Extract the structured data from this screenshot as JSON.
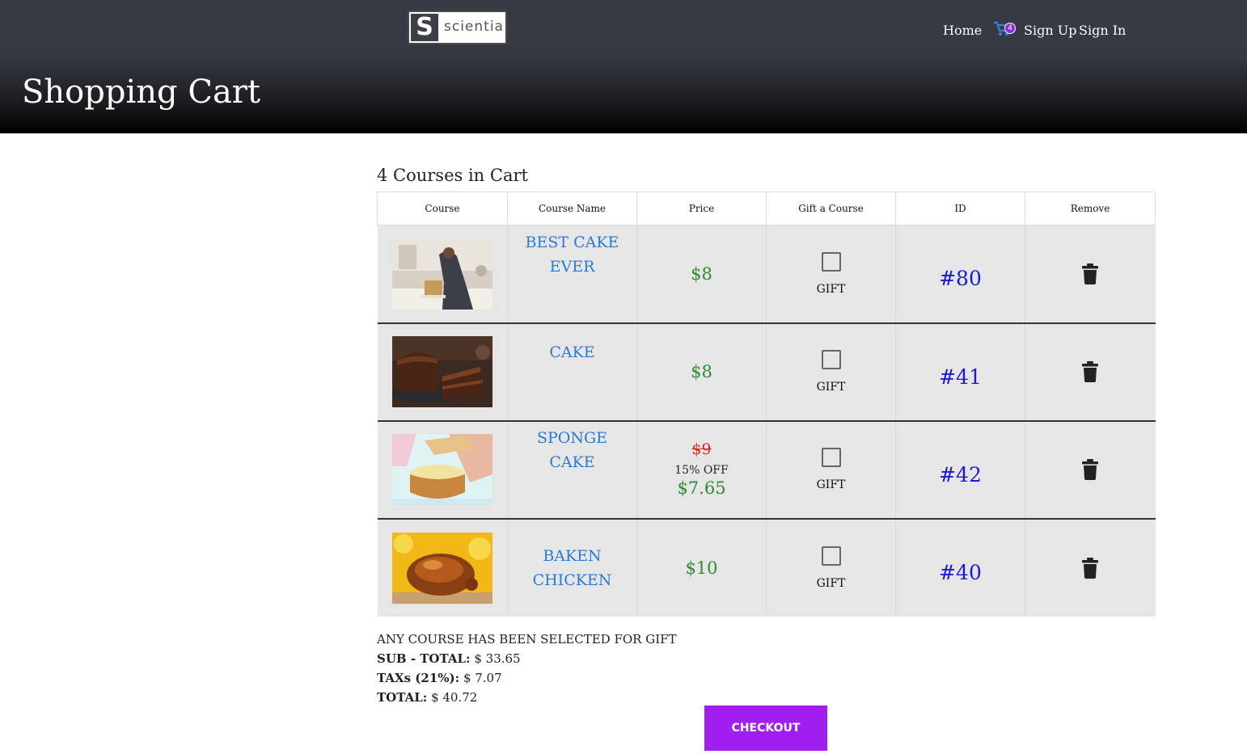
{
  "brand": {
    "logo_letter": "S",
    "logo_text": "scientia"
  },
  "nav": {
    "home": "Home",
    "cart_count": "4",
    "sign_up": "Sign Up",
    "sign_in": "Sign In"
  },
  "page": {
    "title": "Shopping Cart"
  },
  "cart": {
    "heading": "4 Courses in Cart",
    "columns": [
      "Course",
      "Course Name",
      "Price",
      "Gift a Course",
      "ID",
      "Remove"
    ],
    "items": [
      {
        "name": "BEST CAKE EVER",
        "price": "$8",
        "gift_label": "GIFT",
        "gift_checked": false,
        "id": "#80",
        "image": "baker-decorating-cake"
      },
      {
        "name": "CAKE",
        "price": "$8",
        "gift_label": "GIFT",
        "gift_checked": false,
        "id": "#41",
        "image": "chocolate-cake-slice"
      },
      {
        "name": "SPONGE CAKE",
        "old_price": "$9",
        "discount": "15% OFF",
        "price": "$7.65",
        "gift_label": "GIFT",
        "gift_checked": false,
        "id": "#42",
        "image": "sponge-cake"
      },
      {
        "name": "BAKEN CHICKEN",
        "price": "$10",
        "gift_label": "GIFT",
        "gift_checked": false,
        "id": "#40",
        "image": "roast-chicken"
      }
    ]
  },
  "summary": {
    "gift_note": "ANY COURSE HAS BEEN SELECTED FOR GIFT",
    "subtotal_label": "SUB - TOTAL:",
    "subtotal_value": "$ 33.65",
    "tax_label": "TAXs (21%):",
    "tax_value": "$ 7.07",
    "total_label": "TOTAL:",
    "total_value": "$ 40.72"
  },
  "checkout_label": "CHECKOUT",
  "colors": {
    "accent": "#a01ef0",
    "link": "#2a7bd5",
    "price": "#2e8b2e",
    "id": "#1a1ad6",
    "strike": "#e02020",
    "row_bg": "#e6e6e6"
  }
}
